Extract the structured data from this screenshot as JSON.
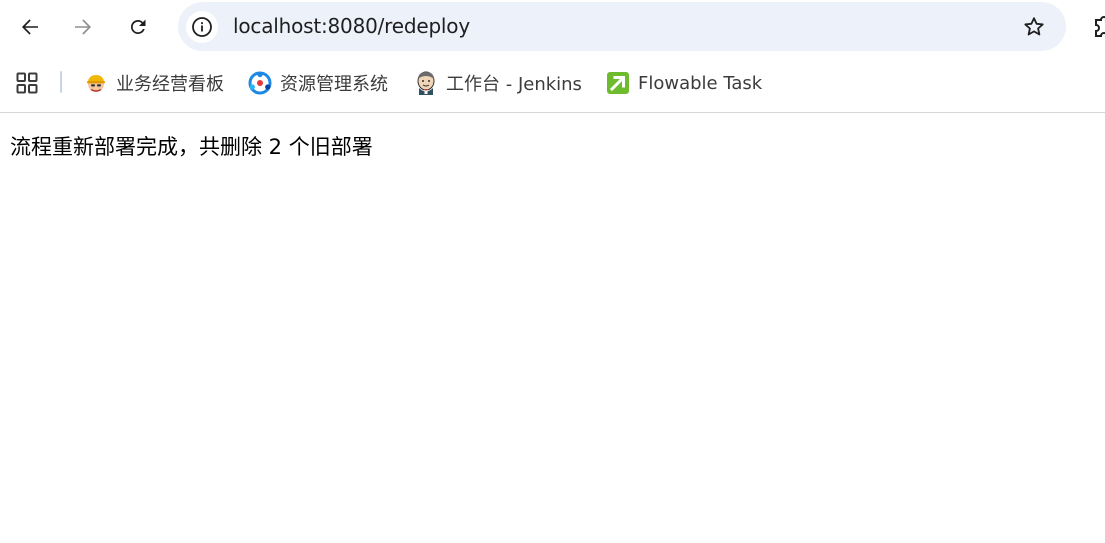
{
  "browser": {
    "url": "localhost:8080/redeploy",
    "bookmarks": [
      {
        "label": "业务经营看板",
        "icon": "worker-avatar-icon"
      },
      {
        "label": "资源管理系统",
        "icon": "resource-logo-icon"
      },
      {
        "label": "工作台 - Jenkins",
        "icon": "jenkins-icon"
      },
      {
        "label": "Flowable Task",
        "icon": "flowable-icon"
      }
    ]
  },
  "page": {
    "message": "流程重新部署完成，共删除 2 个旧部署"
  },
  "colors": {
    "omnibox_bg": "#edf2fa",
    "flowable_green": "#6ebc2e",
    "resource_blue": "#1e88e5"
  }
}
